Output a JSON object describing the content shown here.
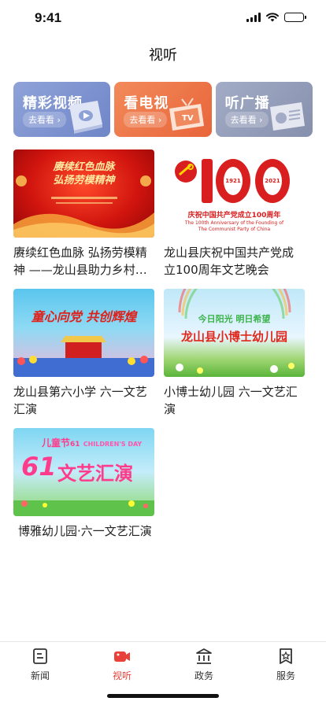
{
  "status_bar": {
    "time": "9:41"
  },
  "page": {
    "title": "视听"
  },
  "categories": [
    {
      "title": "精彩视频",
      "sub": "去看看",
      "icon": "video-player-icon"
    },
    {
      "title": "看电视",
      "sub": "去看看",
      "icon": "tv-icon"
    },
    {
      "title": "听广播",
      "sub": "去看看",
      "icon": "radio-icon"
    }
  ],
  "videos": [
    {
      "title": "赓续红色血脉 弘扬劳模精神 ——龙山县助力乡村振兴先进事迹报告会",
      "thumb_text": [
        "赓续红色血脉",
        "弘扬劳模精神"
      ]
    },
    {
      "title": "龙山县庆祝中国共产党成立100周年文艺晚会",
      "thumb_text": [
        "100",
        "1921",
        "2021",
        "庆祝中国共产党成立100周年",
        "The 100th Anniversary of the Founding of",
        "The Communist Party of China"
      ]
    },
    {
      "title": "龙山县第六小学 六一文艺汇演",
      "thumb_text": [
        "童心向党",
        "共创辉煌"
      ]
    },
    {
      "title": "小博士幼儿园 六一文艺汇演",
      "thumb_text": [
        "今日阳光  明日希望",
        "龙山县小博士幼儿园"
      ]
    },
    {
      "title": "博雅幼儿园·六一文艺汇演",
      "thumb_text": [
        "儿童节",
        "61",
        "文艺汇演",
        "CHILDREN'S DAY"
      ]
    }
  ],
  "tabs": [
    {
      "label": "新闻",
      "icon": "news-icon",
      "active": false
    },
    {
      "label": "视听",
      "icon": "camera-icon",
      "active": true
    },
    {
      "label": "政务",
      "icon": "government-icon",
      "active": false
    },
    {
      "label": "服务",
      "icon": "service-icon",
      "active": false
    }
  ],
  "colors": {
    "accent": "#e8413a",
    "card_video": "#7a8fd0",
    "card_tv": "#ec7547",
    "card_radio": "#959eba"
  }
}
